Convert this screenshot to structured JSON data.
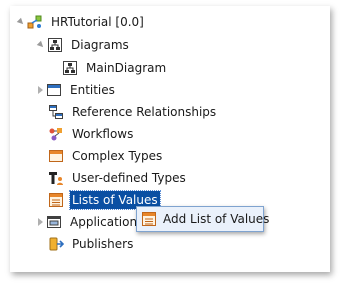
{
  "tree": {
    "root": {
      "label": "HRTutorial [0.0]",
      "icon": "project-icon"
    },
    "items": [
      {
        "label": "Diagrams",
        "icon": "diagrams-icon",
        "expanded": true
      },
      {
        "label": "MainDiagram",
        "icon": "diagram-icon"
      },
      {
        "label": "Entities",
        "icon": "entities-icon",
        "expanded": false
      },
      {
        "label": "Reference Relationships",
        "icon": "relationships-icon"
      },
      {
        "label": "Workflows",
        "icon": "workflows-icon"
      },
      {
        "label": "Complex Types",
        "icon": "complex-types-icon"
      },
      {
        "label": "User-defined Types",
        "icon": "user-types-icon"
      },
      {
        "label": "Lists of Values",
        "icon": "lists-of-values-icon",
        "selected": true
      },
      {
        "label": "Applications",
        "icon": "applications-icon",
        "expanded": false
      },
      {
        "label": "Publishers",
        "icon": "publishers-icon"
      }
    ]
  },
  "context_menu": {
    "items": [
      {
        "label": "Add List of Values",
        "icon": "list-of-values-icon"
      }
    ]
  },
  "colors": {
    "selection": "#0a4fa3",
    "menu_background": "#eaf1fb",
    "menu_border": "#7fa3cf"
  }
}
